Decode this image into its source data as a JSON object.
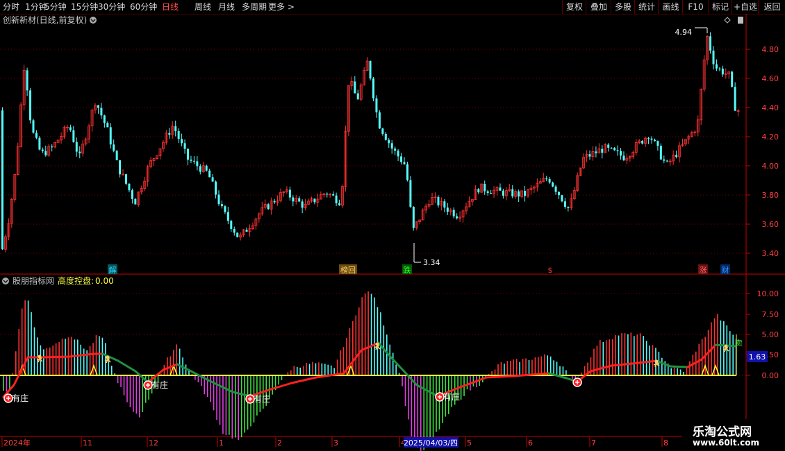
{
  "toolbar": {
    "left_items": [
      "分时",
      "1分钟",
      "5分钟",
      "15分钟",
      "30分钟",
      "60分钟",
      "日线",
      "周线",
      "月线",
      "多周期",
      "更多 >"
    ],
    "active_item": "日线",
    "right_items": [
      "复权",
      "叠加",
      "多股",
      "统计",
      "画线",
      "F10",
      "标记",
      "+自选",
      "返回"
    ]
  },
  "main_chart": {
    "title": "创新新材(日线,前复权)",
    "y_ticks": [
      "4.80",
      "4.60",
      "4.40",
      "4.20",
      "4.00",
      "3.80",
      "3.60",
      "3.40"
    ],
    "high_label": "4.94",
    "low_label": "3.34",
    "event_tags": [
      {
        "text": "解",
        "color": "#33ccee"
      },
      {
        "text": "榜回",
        "color": "#ffcc66"
      },
      {
        "text": "跌",
        "color": "#33ff33"
      },
      {
        "text": "$",
        "color": "#ff3333"
      },
      {
        "text": "涨",
        "color": "#ff6666"
      },
      {
        "text": "财",
        "color": "#3399ff"
      }
    ]
  },
  "indicator": {
    "name": "股朋指标网",
    "param_label": "高度控盘:",
    "param_value": "0.00",
    "y_ticks": [
      "10.00",
      "7.50",
      "5.00",
      "2.50",
      "0.00"
    ],
    "current_value": "1.63",
    "markers": [
      "有庄",
      "有庄",
      "有庄",
      "有庄"
    ],
    "sell_label": "卖"
  },
  "x_axis": {
    "labels": [
      "2024年",
      "11",
      "12",
      "1",
      "2",
      "3",
      "4",
      "5",
      "6",
      "7",
      "8"
    ],
    "cursor_date": "2025/04/03/四"
  },
  "watermark": {
    "title": "乐淘公式网",
    "url": "www.60lt.com"
  },
  "colors": {
    "up": "#ff3232",
    "down": "#54fcfc",
    "grid": "#7a0000",
    "axis_red": "#c80000"
  },
  "icons": [
    "chevron-down-icon",
    "diamond-icon",
    "scroll-icon",
    "plus-circle-icon",
    "runner-icon"
  ]
}
